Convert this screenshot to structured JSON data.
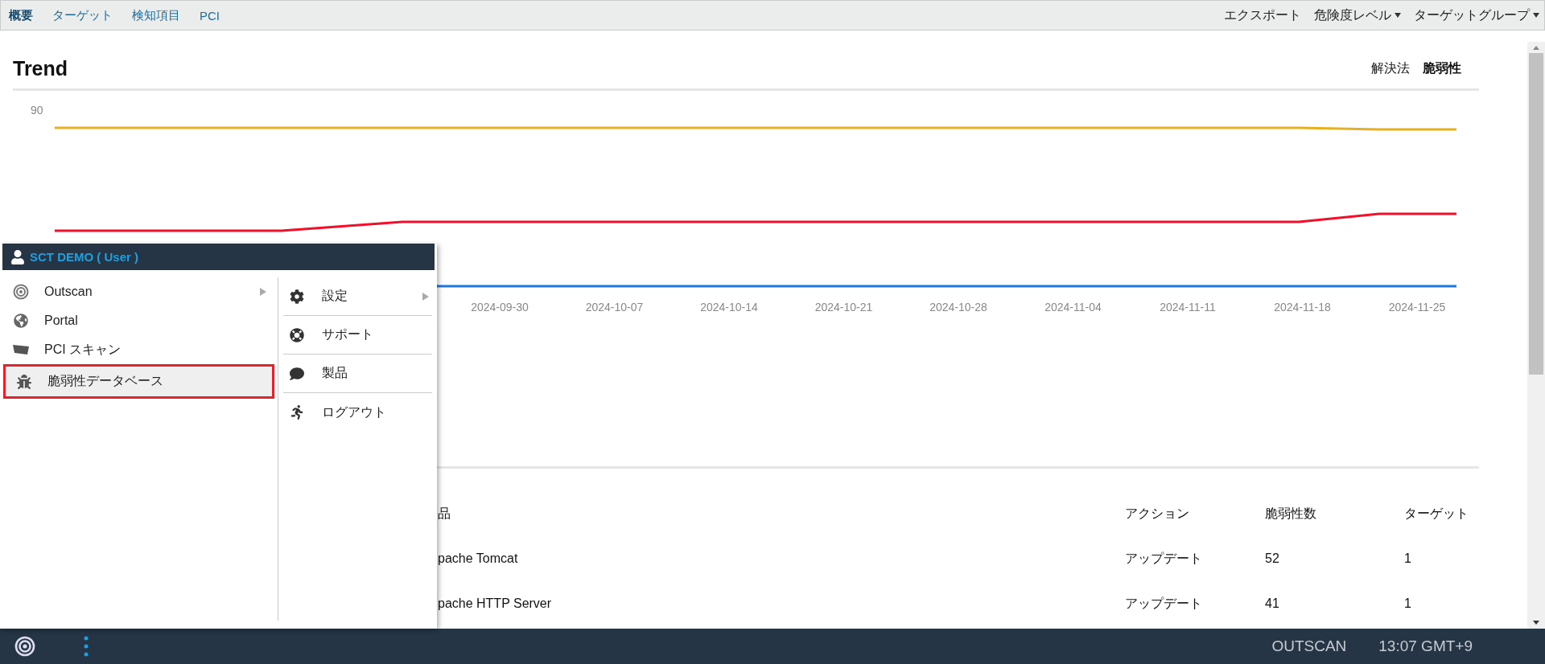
{
  "nav_tabs": [
    {
      "label": "概要",
      "selected": true
    },
    {
      "label": "ターゲット",
      "selected": false
    },
    {
      "label": "検知項目",
      "selected": false
    },
    {
      "label": "PCI",
      "selected": false
    }
  ],
  "toolbar": [
    {
      "label": "エクスポート",
      "dropdown": false
    },
    {
      "label": "危険度レベル",
      "dropdown": true
    },
    {
      "label": "ターゲットグループ",
      "dropdown": true
    }
  ],
  "trend": {
    "title": "Trend",
    "views": [
      {
        "label": "解決法",
        "selected": false
      },
      {
        "label": "脆弱性",
        "selected": true
      }
    ],
    "y_tick": "90",
    "x_labels": [
      "2024-09-30",
      "2024-10-07",
      "2024-10-14",
      "2024-10-21",
      "2024-10-28",
      "2024-11-04",
      "2024-11-11",
      "2024-11-18",
      "2024-11-25"
    ]
  },
  "table": {
    "columns": [
      "品",
      "アクション",
      "脆弱性数",
      "ターゲット"
    ],
    "rows": [
      [
        "pache Tomcat",
        "アップデート",
        "52",
        "1"
      ],
      [
        "pache HTTP Server",
        "アップデート",
        "41",
        "1"
      ]
    ]
  },
  "user_menu": {
    "title": "SCT DEMO ( User )",
    "left_items": [
      {
        "label": "Outscan",
        "kind": "target",
        "submenu": true,
        "selected": false
      },
      {
        "label": "Portal",
        "kind": "globe",
        "submenu": false,
        "selected": false
      },
      {
        "label": "PCI スキャン",
        "kind": "pci",
        "submenu": false,
        "selected": false
      },
      {
        "label": "脆弱性データベース",
        "kind": "bug",
        "submenu": false,
        "selected": true
      }
    ],
    "right_items": [
      {
        "label": "設定",
        "kind": "gear",
        "submenu": true
      },
      {
        "label": "サポート",
        "kind": "lifebuoy",
        "submenu": false
      },
      {
        "label": "製品",
        "kind": "speech",
        "submenu": false
      },
      {
        "label": "ログアウト",
        "kind": "runner",
        "submenu": false
      }
    ]
  },
  "status_bar": {
    "product": "OUTSCAN",
    "time": "13:07 GMT+9"
  }
}
